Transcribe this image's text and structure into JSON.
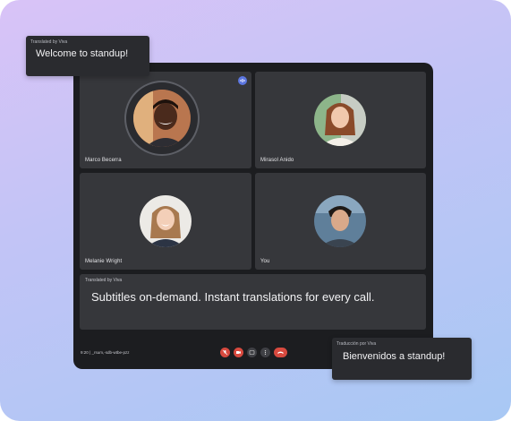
{
  "top_card": {
    "label": "Translated by Viva",
    "text": "Welcome to standup!"
  },
  "bottom_card": {
    "label": "Traducción por Viva",
    "text": "Bienvenidos a standup!"
  },
  "participants": [
    {
      "name": "Marco Becerra",
      "speaking": true
    },
    {
      "name": "Mirasol Anido"
    },
    {
      "name": "Melanie Wright"
    },
    {
      "name": "You"
    }
  ],
  "caption_panel": {
    "label": "Translated by Viva",
    "text": "Subtitles on-demand. Instant translations for every call."
  },
  "status": {
    "time": "9:20",
    "meeting_code": "_rsum,-sdb-wtbe-pzz"
  },
  "controls": [
    {
      "icon": "mic-off-icon",
      "color": "#d84a3f"
    },
    {
      "icon": "camera-off-icon",
      "color": "#d84a3f"
    },
    {
      "icon": "captions-icon",
      "color": "#3f4045"
    },
    {
      "icon": "more-options-icon",
      "color": "#3f4045"
    },
    {
      "icon": "hang-up-icon",
      "color": "#d84a3f"
    }
  ],
  "colors": {
    "window": "#1c1d20",
    "tile": "#36373b",
    "accent": "#5c76e0",
    "danger": "#d84a3f"
  }
}
